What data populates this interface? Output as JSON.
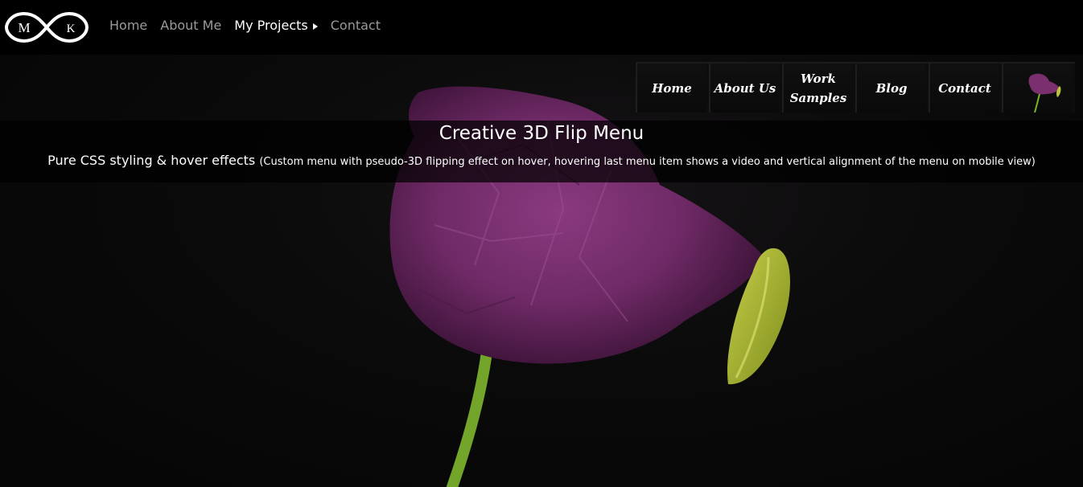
{
  "topbar": {
    "logo_text": "MK",
    "nav": [
      {
        "label": "Home"
      },
      {
        "label": "About Me"
      },
      {
        "label": "My Projects"
      },
      {
        "label": "Contact"
      }
    ]
  },
  "flip_menu": {
    "items": [
      {
        "label": "Home"
      },
      {
        "label": "About Us"
      },
      {
        "label": "Work Samples"
      },
      {
        "label": "Blog"
      },
      {
        "label": "Contact"
      }
    ],
    "video_icon": "poppy-thumbnail-icon"
  },
  "banner": {
    "title": "Creative 3D Flip Menu",
    "subtitle_main": "Pure CSS styling & hover effects",
    "subtitle_detail": "(Custom menu with pseudo-3D flipping effect on hover, hovering last menu item shows a video and vertical alignment of the menu on mobile view)"
  },
  "colors": {
    "background": "#050505",
    "nav_text": "#9a9a9a",
    "nav_active": "#ffffff",
    "flower": "#7a2f6e",
    "stem": "#7db229"
  }
}
